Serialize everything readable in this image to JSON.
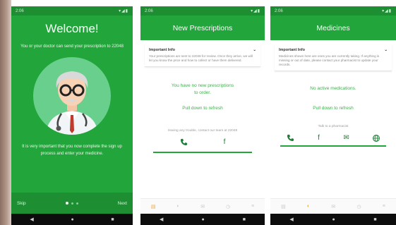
{
  "welcome": {
    "title": "Welcome!",
    "subtitle": "You or your doctor can send your prescription to 22048",
    "body": "It is very important that you now complete the sign up process and enter your medicine.",
    "skip": "Skip",
    "next": "Next",
    "pages": 3,
    "active_page": 1
  },
  "prescriptions": {
    "title": "New Prescriptions",
    "info_title": "Important Info",
    "info_text": "Your prescriptions are sent to 22048 for review. Once they arrive, we will let you know the price and how to collect or have them delivered.",
    "empty_line1": "You have no new prescriptions",
    "empty_line2": "to order.",
    "refresh": "Pull down to refresh",
    "contact": "Having any trouble, contact our team at 22048"
  },
  "medicines": {
    "title": "Medicines",
    "info_title": "Important Info",
    "info_text": "Medicines shown here are ones you are currently taking. If anything is missing or out of date, please contact your pharmacist to update your records.",
    "empty": "No active medications.",
    "refresh": "Pull down to refresh",
    "contact": "Talk to a pharmacist"
  },
  "status_time": "2:06",
  "nav_glyphs": {
    "back": "◀",
    "home": "●",
    "recents": "■"
  },
  "colors": {
    "primary": "#22a53a",
    "dark": "#1d8f32",
    "accent": "#f0a93a"
  }
}
